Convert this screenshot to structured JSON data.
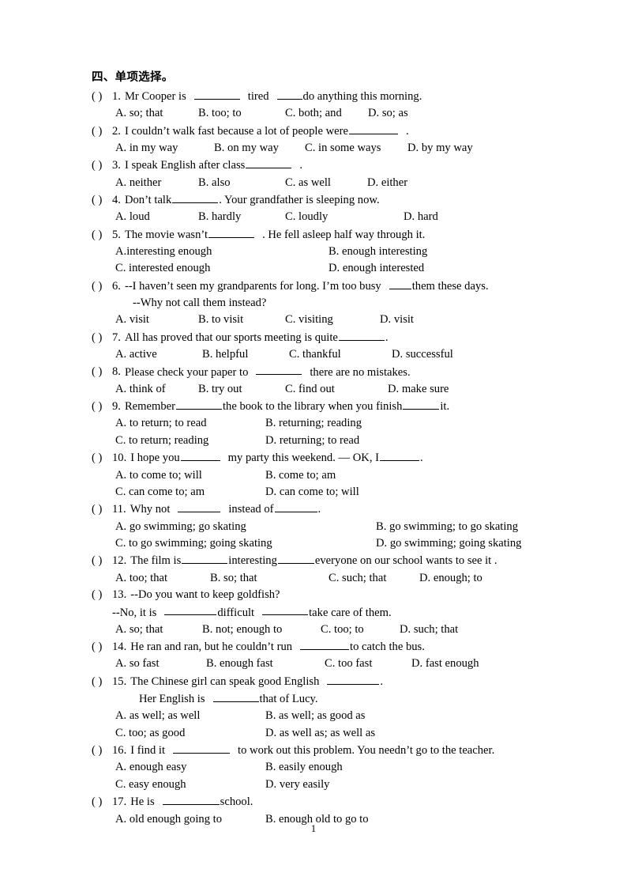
{
  "document": {
    "section_title": "四、单项选择。",
    "page_number": "1"
  },
  "questions": [
    {
      "marker": "( )",
      "number": "1.",
      "stem_before": "Mr Cooper is",
      "stem_mid": "tired",
      "stem_after": "do anything this morning.",
      "options": [
        "A. so; that",
        "B. too; to",
        "C. both; and",
        "D. so; as"
      ]
    },
    {
      "marker": "( )",
      "number": "2.",
      "stem_before": "I couldn’t walk fast because a lot of people were",
      "stem_after": ".",
      "options": [
        "A. in my way",
        "B. on my way",
        "C. in some ways",
        "D. by my way"
      ]
    },
    {
      "marker": "( )",
      "number": "3.",
      "stem_before": "I speak English after class",
      "stem_after": ".",
      "options": [
        "A.  neither",
        "B. also",
        "C. as well",
        "D. either"
      ]
    },
    {
      "marker": "( )",
      "number": "4.",
      "stem_before": "Don’t talk",
      "stem_after": ". Your grandfather is sleeping now.",
      "options": [
        "A. loud",
        "B. hardly",
        "C. loudly",
        "D. hard"
      ]
    },
    {
      "marker": "( )",
      "number": "5.",
      "stem_before": "The movie wasn’t",
      "stem_after": ". He fell asleep half way through it.",
      "options": [
        "A.interesting enough",
        "B. enough interesting",
        "C. interested enough",
        "D. enough interested"
      ]
    },
    {
      "marker": "( )",
      "number": "6.",
      "stem_before": "--I haven’t seen my grandparents for long. I’m too busy",
      "stem_after": "them these days.",
      "stem_line2": "--Why not call them instead?",
      "options": [
        "A. visit",
        "B. to visit",
        "C. visiting",
        "D. visit"
      ]
    },
    {
      "marker": "( )",
      "number": "7.",
      "stem_before": "All has proved that our sports meeting is quite",
      "stem_after": ".",
      "options": [
        "A. active",
        "B. helpful",
        "C. thankful",
        "D. successful"
      ]
    },
    {
      "marker": "( )",
      "number": "8.",
      "stem_before": "Please check your paper to",
      "stem_after": "there are no mistakes.",
      "options": [
        "A. think of",
        "B. try out",
        "C. find out",
        "D. make sure"
      ]
    },
    {
      "marker": "( )",
      "number": "9.",
      "stem_before": "Remember",
      "stem_mid": "the book to the library when you finish",
      "stem_after": "it.",
      "options": [
        "A. to return; to read",
        "B. returning; reading",
        "C. to return; reading",
        "D. returning; to read"
      ]
    },
    {
      "marker": "( )",
      "number": "10.",
      "stem_before": "I hope you",
      "stem_mid": "my party this weekend. — OK, I",
      "stem_after": ".",
      "options": [
        "A. to come to; will",
        "B. come to; am",
        "C. can come to; am",
        "D. can come to; will"
      ]
    },
    {
      "marker": "( )",
      "number": "11.",
      "stem_before": "Why not",
      "stem_mid": "instead of",
      "stem_after": ".",
      "options": [
        "A. go swimming; go skating",
        "B. go swimming; to go skating",
        "C. to go swimming; going skating",
        "D. go swimming; going skating"
      ]
    },
    {
      "marker": "( )",
      "number": "12.",
      "stem_before": "The film is",
      "stem_mid": "interesting",
      "stem_after": "everyone on our school wants to see it .",
      "options": [
        "A. too; that",
        "B. so; that",
        "C. such; that",
        "D. enough; to"
      ]
    },
    {
      "marker": "( )",
      "number": "13.",
      "stem_before": "--Do you want to keep goldfish?",
      "stem_line2_a": "--No, it is",
      "stem_line2_b": "difficult",
      "stem_line2_c": "take care of them.",
      "options": [
        "A. so; that",
        "B. not; enough to",
        "C. too; to",
        "D. such; that"
      ]
    },
    {
      "marker": "( )",
      "number": "14.",
      "stem_before": "He ran and ran, but he couldn’t run",
      "stem_after": "to catch the bus.",
      "options": [
        "A. so fast",
        "B. enough fast",
        "C. too fast",
        "D. fast enough"
      ]
    },
    {
      "marker": "( )",
      "number": "15.",
      "stem_before": "The Chinese girl can speak good English",
      "stem_after": ".",
      "stem_line2_a": "Her English is",
      "stem_line2_b": "that of Lucy.",
      "options": [
        "A. as well; as well",
        "B. as well; as good as",
        "C. too; as good",
        "D. as well as; as well as"
      ]
    },
    {
      "marker": "( )",
      "number": "16.",
      "stem_before": "I find it",
      "stem_after": "to work out this problem. You needn’t go to the teacher.",
      "options": [
        "A. enough easy",
        "B. easily enough",
        "C. easy enough",
        "D. very easily"
      ]
    },
    {
      "marker": "( )",
      "number": "17.",
      "stem_before": "He is",
      "stem_after": "school.",
      "options": [
        "A. old enough going to",
        "B. enough old to go to"
      ]
    }
  ]
}
